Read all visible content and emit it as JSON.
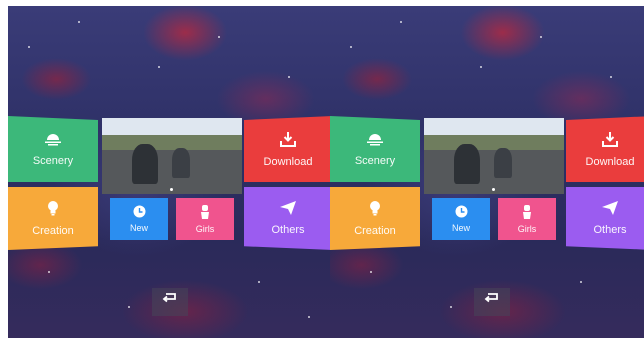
{
  "tiles": {
    "scenery": "Scenery",
    "creation": "Creation",
    "new": "New",
    "girls": "Girls",
    "download": "Download",
    "others": "Others"
  },
  "colors": {
    "scenery": "#3cb87a",
    "creation": "#f7a93a",
    "new": "#2b8ef0",
    "girls": "#f0548e",
    "download": "#ea3d3d",
    "others": "#9b5cf0"
  },
  "icons": {
    "scenery": "sunset-icon",
    "creation": "lightbulb-icon",
    "new": "clock-icon",
    "girls": "girl-icon",
    "download": "download-icon",
    "others": "paper-plane-icon",
    "back": "back-arrow-icon",
    "video": "video-thumbnail"
  }
}
